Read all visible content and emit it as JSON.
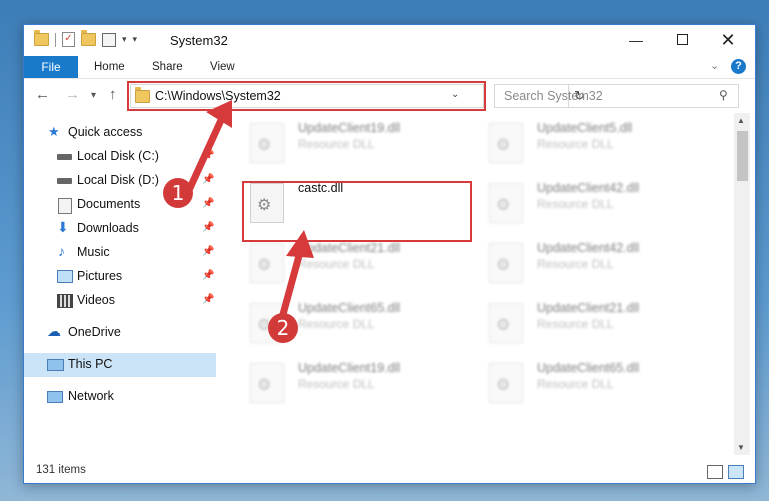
{
  "window": {
    "title": "System32"
  },
  "ribbon": {
    "tabs": [
      "File",
      "Home",
      "Share",
      "View"
    ]
  },
  "address": {
    "path": "C:\\Windows\\System32"
  },
  "search": {
    "placeholder": "Search System32"
  },
  "sidebar": {
    "items": [
      {
        "label": "Quick access",
        "icon": "star-icon"
      },
      {
        "label": "Local Disk (C:)",
        "icon": "drive-icon",
        "pinned": true
      },
      {
        "label": "Local Disk (D:)",
        "icon": "drive-icon",
        "pinned": true
      },
      {
        "label": "Documents",
        "icon": "documents-icon",
        "pinned": true
      },
      {
        "label": "Downloads",
        "icon": "download-arrow-icon",
        "pinned": true
      },
      {
        "label": "Music",
        "icon": "music-note-icon",
        "pinned": true
      },
      {
        "label": "Pictures",
        "icon": "pictures-icon",
        "pinned": true
      },
      {
        "label": "Videos",
        "icon": "film-icon",
        "pinned": true
      },
      {
        "label": "OneDrive",
        "icon": "cloud-icon"
      },
      {
        "label": "This PC",
        "icon": "monitor-icon",
        "selected": true
      },
      {
        "label": "Network",
        "icon": "network-icon"
      }
    ]
  },
  "files": [
    {
      "name": "UpdateClient19.dll",
      "desc": "Resource DLL",
      "blurred": true
    },
    {
      "name": "UpdateClient5.dll",
      "desc": "Resource DLL",
      "blurred": true
    },
    {
      "name": "castc.dll",
      "desc": "",
      "blurred": false
    },
    {
      "name": "UpdateClient42.dll",
      "desc": "Resource DLL",
      "blurred": true
    },
    {
      "name": "UpdateClient21.dll",
      "desc": "Resource DLL",
      "blurred": true
    },
    {
      "name": "UpdateClient42.dll",
      "desc": "Resource DLL",
      "blurred": true
    },
    {
      "name": "UpdateClient65.dll",
      "desc": "Resource DLL",
      "blurred": true
    },
    {
      "name": "UpdateClient21.dll",
      "desc": "Resource DLL",
      "blurred": true
    },
    {
      "name": "UpdateClient19.dll",
      "desc": "Resource DLL",
      "blurred": true
    },
    {
      "name": "UpdateClient65.dll",
      "desc": "Resource DLL",
      "blurred": true
    }
  ],
  "status": {
    "items": "131 items"
  },
  "annotations": {
    "step1": "1",
    "step2": "2",
    "color": "#d63a3a"
  }
}
